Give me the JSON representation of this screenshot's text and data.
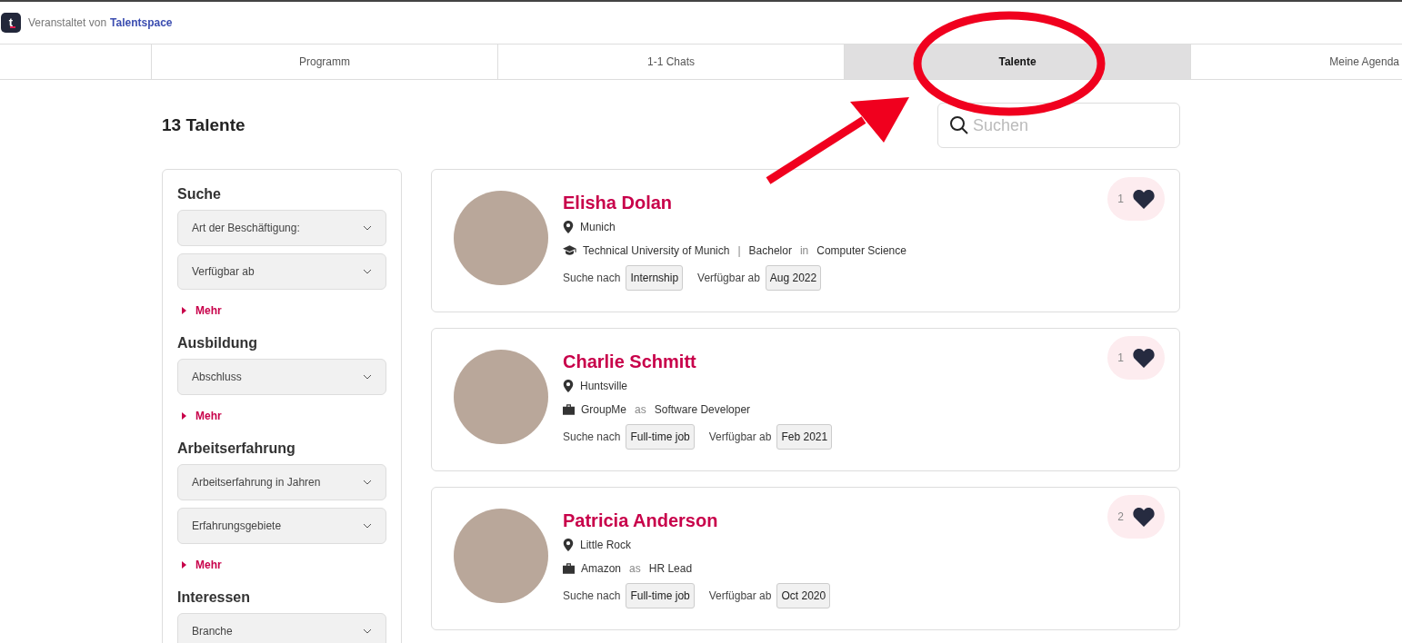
{
  "header": {
    "logo": "t",
    "organizer_prefix": "Veranstaltet von",
    "organizer": "Talentspace"
  },
  "tabs": [
    {
      "label": "Programm",
      "selected": false
    },
    {
      "label": "1-1 Chats",
      "selected": false
    },
    {
      "label": "Talente",
      "selected": true
    },
    {
      "label": "Meine Agenda",
      "selected": false
    }
  ],
  "title": "13 Talente",
  "search": {
    "placeholder": "Suchen"
  },
  "filters": [
    {
      "title": "Suche",
      "dropdowns": [
        "Art der Beschäftigung:",
        "Verfügbar ab"
      ],
      "more": "Mehr"
    },
    {
      "title": "Ausbildung",
      "dropdowns": [
        "Abschluss"
      ],
      "more": "Mehr"
    },
    {
      "title": "Arbeitserfahrung",
      "dropdowns": [
        "Arbeitserfahrung in Jahren",
        "Erfahrungsgebiete"
      ],
      "more": "Mehr"
    },
    {
      "title": "Interessen",
      "dropdowns": [
        "Branche"
      ]
    }
  ],
  "talents": [
    {
      "name": "Elisha Dolan",
      "likes": "1",
      "details": [
        {
          "kind": "location",
          "parts": [
            "Munich"
          ]
        },
        {
          "kind": "education",
          "parts": [
            "Technical University of Munich",
            "|",
            "Bachelor",
            "in",
            "Computer Science"
          ]
        }
      ],
      "looking_label": "Suche nach",
      "looking": "Internship",
      "available_label": "Verfügbar ab",
      "available": "Aug 2022"
    },
    {
      "name": "Charlie Schmitt",
      "likes": "1",
      "details": [
        {
          "kind": "location",
          "parts": [
            "Huntsville"
          ]
        },
        {
          "kind": "job",
          "parts": [
            "GroupMe",
            "as",
            "Software Developer"
          ]
        }
      ],
      "looking_label": "Suche nach",
      "looking": "Full-time job",
      "available_label": "Verfügbar ab",
      "available": "Feb 2021"
    },
    {
      "name": "Patricia Anderson",
      "likes": "2",
      "details": [
        {
          "kind": "location",
          "parts": [
            "Little Rock"
          ]
        },
        {
          "kind": "job",
          "parts": [
            "Amazon",
            "as",
            "HR Lead"
          ]
        }
      ],
      "looking_label": "Suche nach",
      "looking": "Full-time job",
      "available_label": "Verfügbar ab",
      "available": "Oct 2020"
    }
  ]
}
